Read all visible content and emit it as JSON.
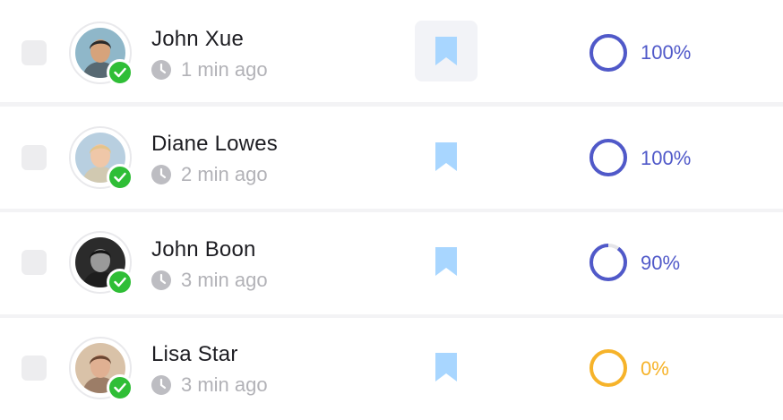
{
  "rows": [
    {
      "name": "John Xue",
      "time": "1 min ago",
      "progress": 100,
      "progress_label": "100%",
      "color": "#5059c9",
      "avatar_bg": "#8fb7c9",
      "avatar_hair": "#2a2a2a",
      "avatar_skin": "#d6a37b",
      "bookmark_active": true
    },
    {
      "name": "Diane Lowes",
      "time": "2 min ago",
      "progress": 100,
      "progress_label": "100%",
      "color": "#5059c9",
      "avatar_bg": "#b8cfe0",
      "avatar_hair": "#e5c48a",
      "avatar_skin": "#efc7a8",
      "bookmark_active": false
    },
    {
      "name": "John Boon",
      "time": "3 min ago",
      "progress": 90,
      "progress_label": "90%",
      "color": "#5059c9",
      "avatar_bg": "#2b2b2b",
      "avatar_hair": "#141414",
      "avatar_skin": "#9a9a9a",
      "bookmark_active": false
    },
    {
      "name": "Lisa Star",
      "time": "3 min ago",
      "progress": 0,
      "progress_label": "0%",
      "color": "#f6b32a",
      "avatar_bg": "#d9c2a8",
      "avatar_hair": "#6a4632",
      "avatar_skin": "#e0b092",
      "bookmark_active": false
    }
  ],
  "colors": {
    "bookmark": "#a8d6ff",
    "verified": "#2fbe36",
    "track": "#e4e4e8"
  },
  "icons": {
    "bookmark": "bookmark-icon",
    "clock": "clock-icon",
    "check": "checkmark-icon"
  }
}
